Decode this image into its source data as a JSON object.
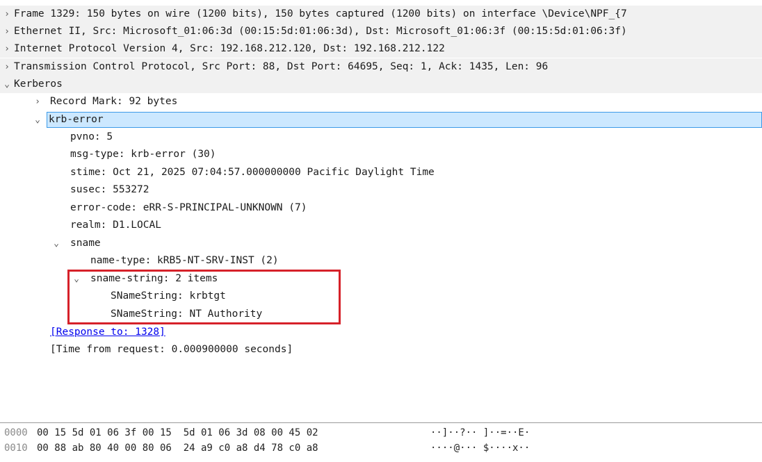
{
  "detail": {
    "rows": [
      "Frame 1329: 150 bytes on wire (1200 bits), 150 bytes captured (1200 bits) on interface \\Device\\NPF_{7",
      "Ethernet II, Src: Microsoft_01:06:3d (00:15:5d:01:06:3d), Dst: Microsoft_01:06:3f (00:15:5d:01:06:3f)",
      "Internet Protocol Version 4, Src: 192.168.212.120, Dst: 192.168.212.122",
      "Transmission Control Protocol, Src Port: 88, Dst Port: 64695, Seq: 1, Ack: 1435, Len: 96",
      "Kerberos",
      "Record Mark: 92 bytes",
      "krb-error",
      "pvno: 5",
      "msg-type: krb-error (30)",
      "stime: Oct 21, 2025 07:04:57.000000000 Pacific Daylight Time",
      "susec: 553272",
      "error-code: eRR-S-PRINCIPAL-UNKNOWN (7)",
      "realm: D1.LOCAL",
      "sname",
      "name-type: kRB5-NT-SRV-INST (2)",
      "sname-string: 2 items",
      "SNameString: krbtgt",
      "SNameString: NT Authority",
      "[Response to: 1328]",
      "[Time from request: 0.000900000 seconds]"
    ]
  },
  "bytes": [
    {
      "offset": "0000",
      "hex": "00 15 5d 01 06 3f 00 15  5d 01 06 3d 08 00 45 02",
      "ascii": "··]··?·· ]··=··E·"
    },
    {
      "offset": "0010",
      "hex": "00 88 ab 80 40 00 80 06  24 a9 c0 a8 d4 78 c0 a8",
      "ascii": "····@··· $····x··"
    }
  ],
  "icons": {
    "collapsed": "chevron-right-icon",
    "expanded": "chevron-down-icon"
  }
}
